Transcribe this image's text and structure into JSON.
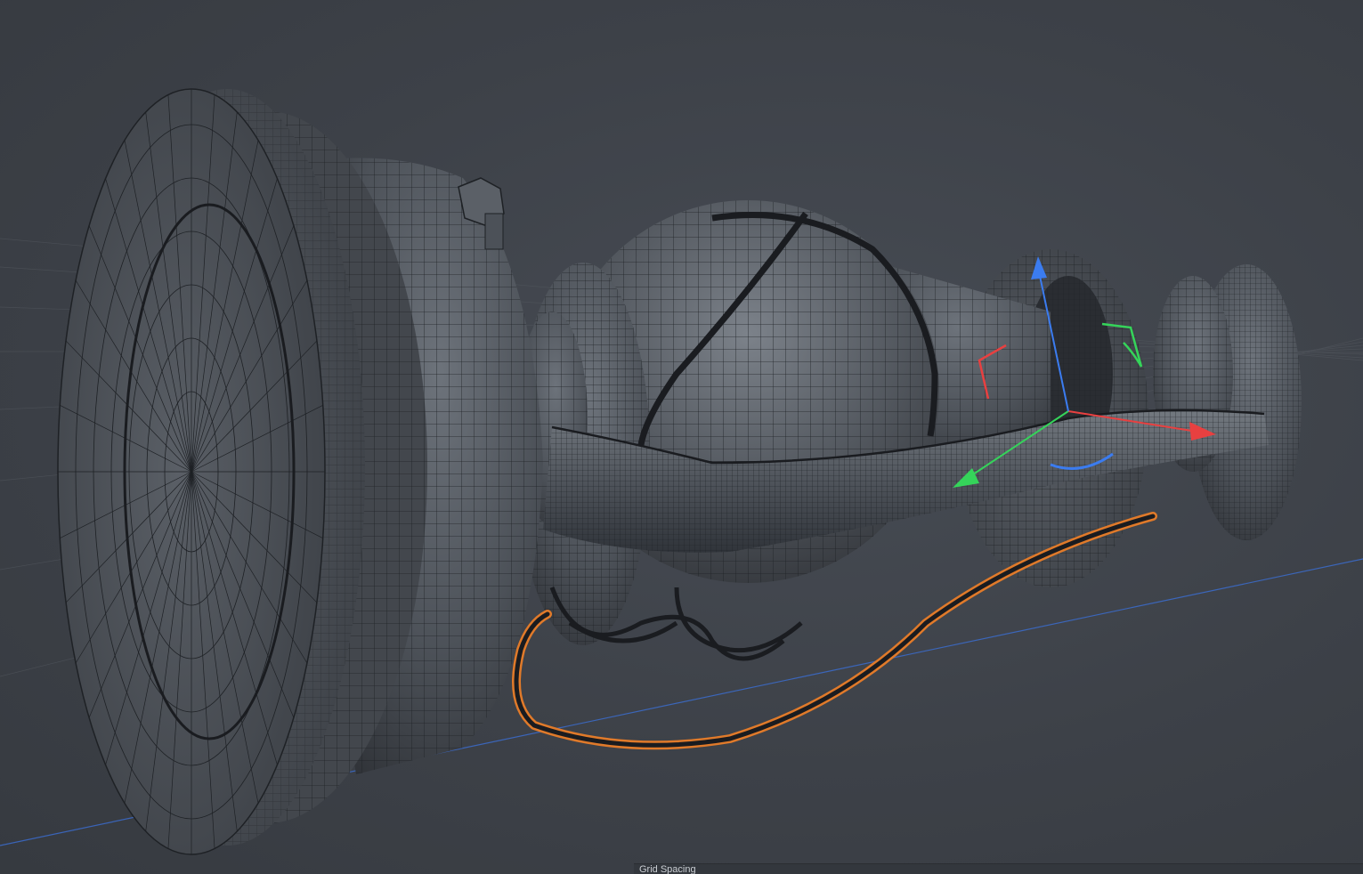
{
  "viewport": {
    "background": "#3f444b",
    "mesh_fill": "#4a4f56",
    "wire_color": "#1e2125",
    "selection_color": "#e07a2a"
  },
  "gizmo": {
    "axis_x_color": "#e84040",
    "axis_y_color": "#35d45a",
    "axis_z_color": "#3b7cf0",
    "handles": [
      "x-axis-arrow",
      "y-axis-arrow",
      "z-axis-arrow",
      "x-rotate-arc",
      "y-rotate-arc",
      "z-rotate-arc"
    ]
  },
  "status": {
    "label": "Grid Spacing"
  }
}
